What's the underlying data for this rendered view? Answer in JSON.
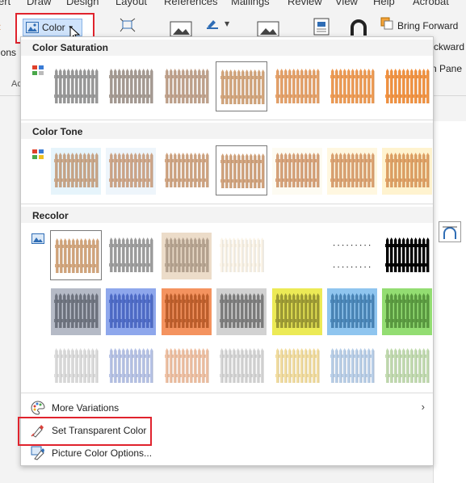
{
  "menubar": [
    "ert",
    "Draw",
    "Design",
    "Layout",
    "References",
    "Mailings",
    "Review",
    "View",
    "Help",
    "Acrobat"
  ],
  "ribbon": {
    "left_fragment_1": "ions",
    "left_fragment_2": "Ac",
    "color_button_label": "Color",
    "bring_forward": "Bring Forward",
    "send_backward_fragment": "ckward",
    "selection_pane_fragment": "n Pane"
  },
  "sections": {
    "saturation": {
      "title": "Color Saturation",
      "presets": 7,
      "selected": 3
    },
    "tone": {
      "title": "Color Tone",
      "presets": 7,
      "selected": 3
    },
    "recolor": {
      "title": "Recolor",
      "selected": 0
    }
  },
  "swatch_colors": {
    "saturation": [
      "#9a9a9a",
      "#a79c94",
      "#c2a48e",
      "#d4a77e",
      "#e6a26a",
      "#ef9c55",
      "#f39443"
    ],
    "tone_fence": [
      "#caa789",
      "#cfa78a",
      "#d1a684",
      "#d2a47e",
      "#d8a37a",
      "#dca372",
      "#e0a165"
    ],
    "tone_bg": [
      "#e6f4fb",
      "#eef5fb",
      "#ffffff",
      "#ffffff",
      "#fdfbf2",
      "#fff7e0",
      "#fff3cf"
    ],
    "recolor_row1": [
      {
        "fence": "#d4a77e",
        "bg": "#ffffff"
      },
      {
        "fence": "#9e9e9e",
        "bg": "#ffffff"
      },
      {
        "fence": "#b8a592",
        "bg": "#ecdcc9"
      },
      {
        "fence": "#fbf4e8",
        "bg": "#ffffff"
      },
      {
        "fence": "#ffffff",
        "bg": "#ffffff"
      },
      {
        "fence": "#222222",
        "bg": "#ffffff"
      },
      {
        "fence": "#000000",
        "bg": "#ffffff"
      }
    ],
    "recolor_row2": [
      {
        "fence": "#6f7480",
        "bg": "#b5bac6"
      },
      {
        "fence": "#4f6cc8",
        "bg": "#8ea7ec"
      },
      {
        "fence": "#c0602d",
        "bg": "#f4935f"
      },
      {
        "fence": "#7e7e7e",
        "bg": "#d2d2d2"
      },
      {
        "fence": "#9e9b35",
        "bg": "#ecea56"
      },
      {
        "fence": "#4a86b8",
        "bg": "#8fc5ef"
      },
      {
        "fence": "#5b9b41",
        "bg": "#93dd72"
      }
    ],
    "recolor_row3": [
      {
        "fence": "#dcdcdc",
        "bg": "#ffffff"
      },
      {
        "fence": "#b7c3e6",
        "bg": "#ffffff"
      },
      {
        "fence": "#efc1a4",
        "bg": "#ffffff"
      },
      {
        "fence": "#d6d6d6",
        "bg": "#ffffff"
      },
      {
        "fence": "#f2dda0",
        "bg": "#ffffff"
      },
      {
        "fence": "#b9cfe8",
        "bg": "#ffffff"
      },
      {
        "fence": "#c2dbb0",
        "bg": "#ffffff"
      }
    ]
  },
  "menu": {
    "more_variations": "More Variations",
    "set_transparent": "Set Transparent Color",
    "picture_options": "Picture Color Options..."
  },
  "accent": {
    "highlight_red": "#e0232d",
    "selected_blue": "#cfe3fb"
  }
}
